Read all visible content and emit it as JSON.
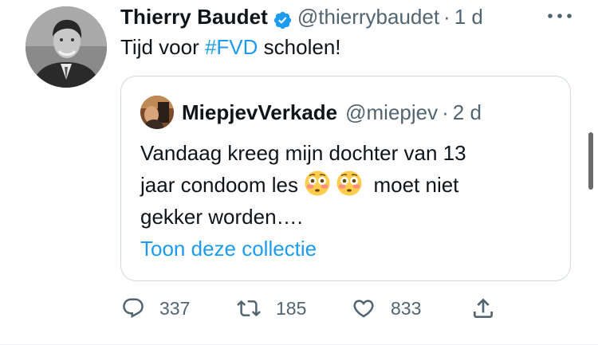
{
  "tweet": {
    "author_name": "Thierry Baudet",
    "author_handle": "@thierrybaudet",
    "separator": "·",
    "time": "1 d",
    "text_prefix": "Tijd voor ",
    "hashtag": "#FVD",
    "text_suffix": " scholen!",
    "verified": true
  },
  "quote": {
    "author_name": "MiepjevVerkade",
    "author_handle": "@miepjev",
    "separator": "·",
    "time": "2 d",
    "line1": "Vandaag kreeg mijn dochter van 13",
    "line2_prefix": "jaar condoom les",
    "emoji": "flushed-face",
    "line2_suffix": " moet niet",
    "line3": "gekker worden….",
    "link_text": "Toon deze collectie"
  },
  "actions": {
    "replies": "337",
    "retweets": "185",
    "likes": "833"
  },
  "icons": {
    "verified": "verified-badge-icon",
    "more": "more-dots-icon",
    "reply": "reply-icon",
    "retweet": "retweet-icon",
    "like": "heart-icon",
    "share": "share-icon"
  },
  "colors": {
    "accent": "#1d9bf0",
    "muted": "#536471",
    "text": "#0f1419",
    "border": "#cfd9de"
  }
}
